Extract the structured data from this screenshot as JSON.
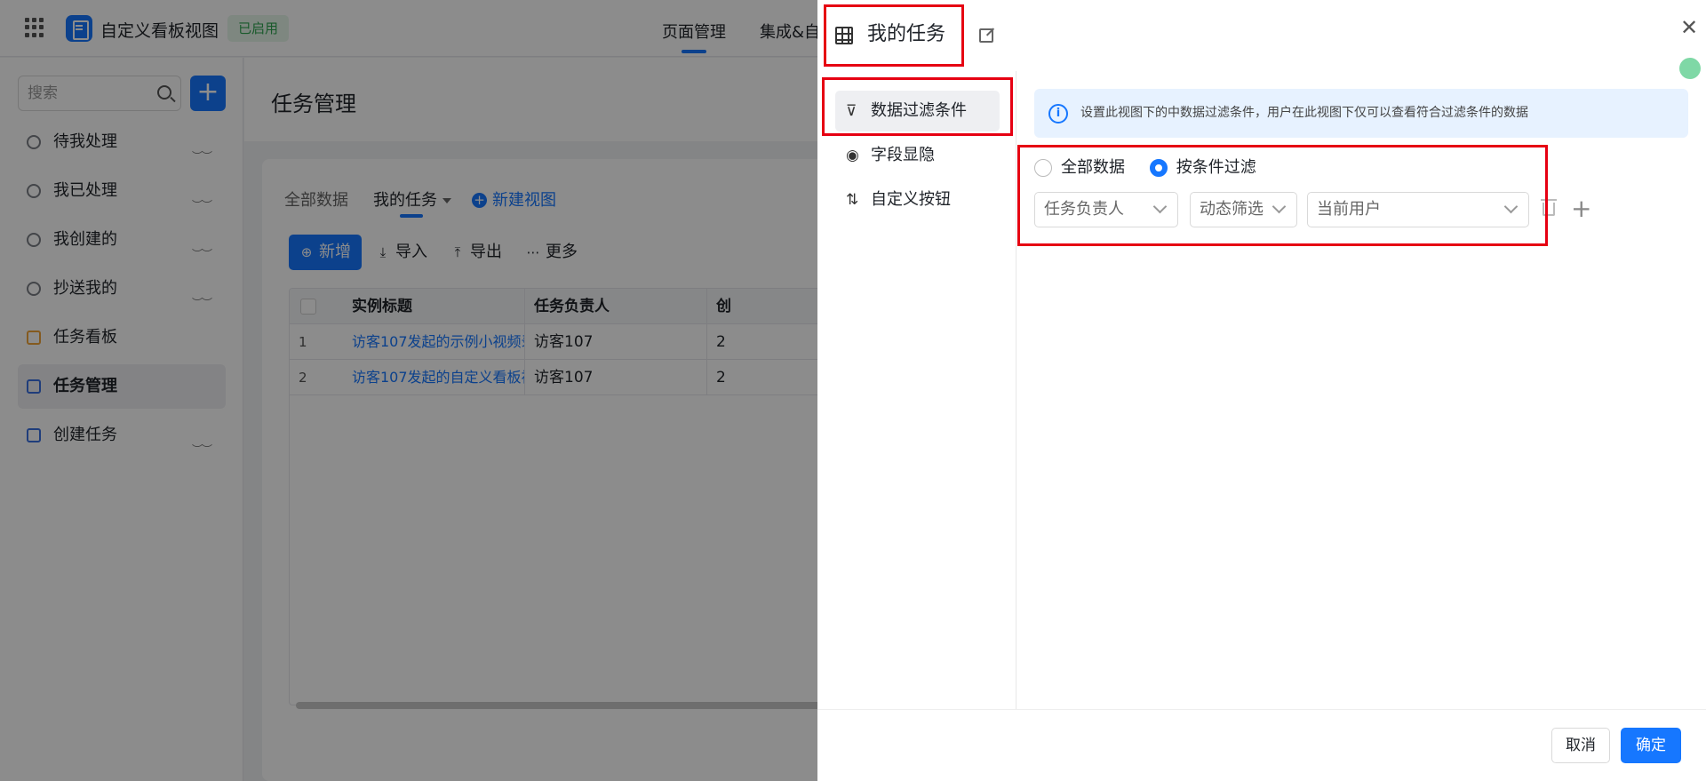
{
  "app": {
    "title": "自定义看板视图",
    "status_badge": "已启用",
    "top_tabs": [
      "页面管理",
      "集成&自"
    ]
  },
  "sidebar": {
    "search_placeholder": "搜索",
    "add_label": "+",
    "items": [
      {
        "label": "待我处理",
        "icon": "clock-icon"
      },
      {
        "label": "我已处理",
        "icon": "user-check-icon"
      },
      {
        "label": "我创建的",
        "icon": "user-icon"
      },
      {
        "label": "抄送我的",
        "icon": "send-icon"
      },
      {
        "label": "任务看板",
        "icon": "board-icon"
      },
      {
        "label": "任务管理",
        "icon": "form-icon",
        "active": true
      },
      {
        "label": "创建任务",
        "icon": "doc-icon"
      }
    ]
  },
  "page": {
    "title": "任务管理",
    "view_tabs": [
      "全部数据",
      "我的任务",
      "新建视图"
    ],
    "toolbar": {
      "add": "新增",
      "import": "导入",
      "export": "导出",
      "more": "更多"
    },
    "table": {
      "headers": [
        "实例标题",
        "任务负责人",
        "创"
      ],
      "rows": [
        {
          "index": "1",
          "title": "访客107发起的示例小视频录...",
          "owner": "访客107",
          "extra": "2"
        },
        {
          "index": "2",
          "title": "访客107发起的自定义看板视...",
          "owner": "访客107",
          "extra": "2"
        }
      ]
    }
  },
  "drawer": {
    "title": "我的任务",
    "menu": [
      "数据过滤条件",
      "字段显隐",
      "自定义按钮"
    ],
    "info": "设置此视图下的中数据过滤条件，用户在此视图下仅可以查看符合过滤条件的数据",
    "radio_all": "全部数据",
    "radio_filter": "按条件过滤",
    "filter": {
      "field": "任务负责人",
      "operator": "动态筛选",
      "value": "当前用户"
    },
    "cancel": "取消",
    "confirm": "确定",
    "highlight_color": "#e60012",
    "accent": "#1677ff"
  }
}
